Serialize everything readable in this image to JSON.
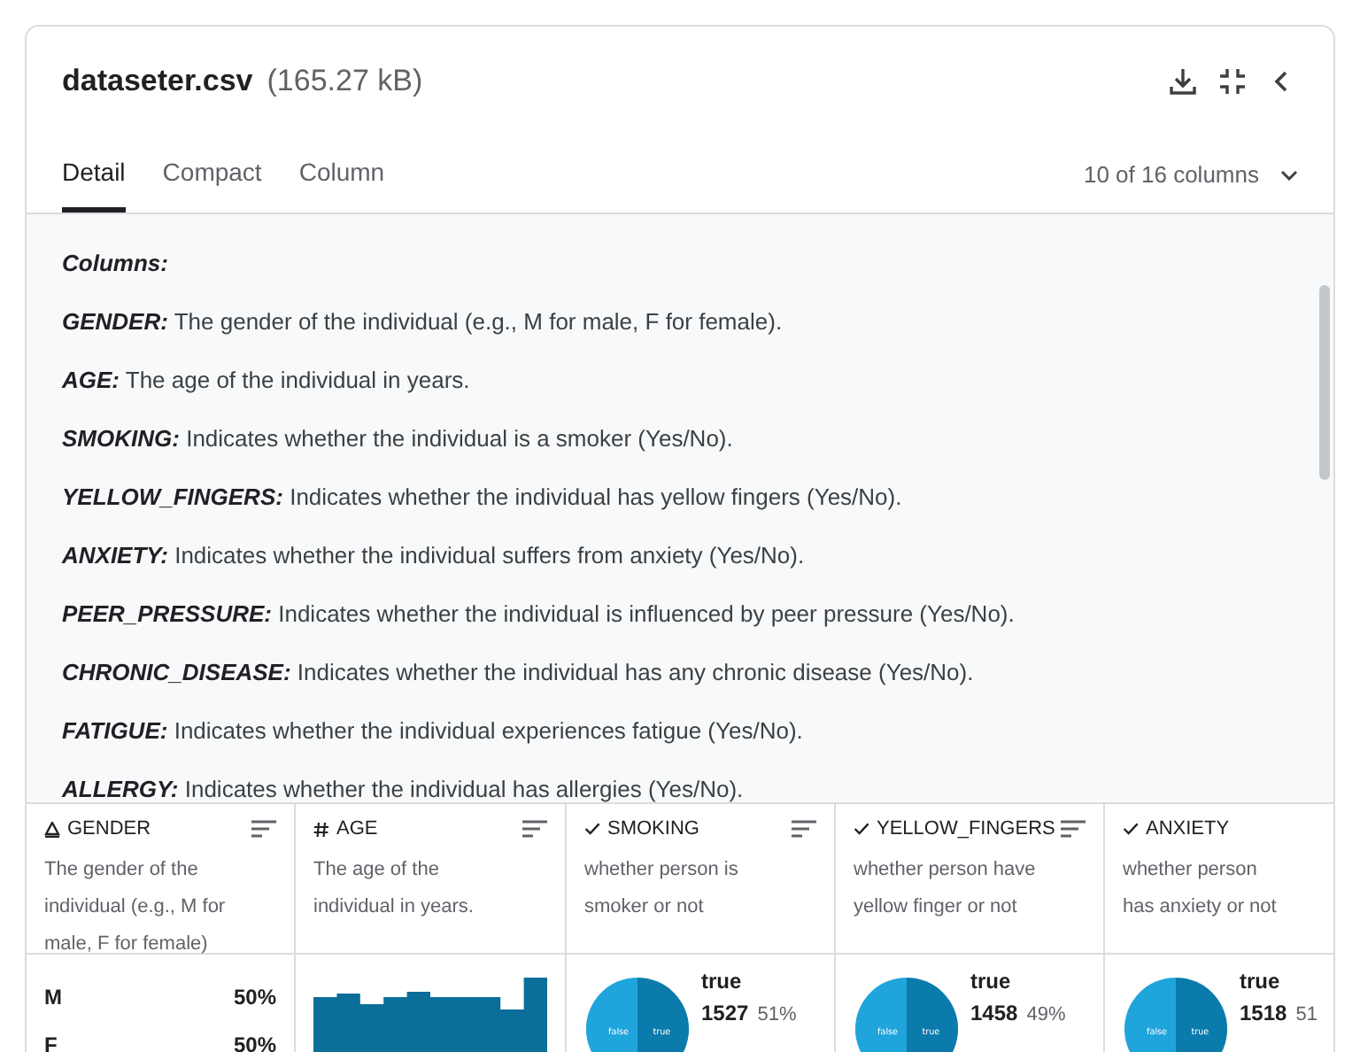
{
  "file": {
    "name": "dataseter.csv",
    "size": "(165.27 kB)"
  },
  "tabs": [
    {
      "label": "Detail",
      "selected": true
    },
    {
      "label": "Compact",
      "selected": false
    },
    {
      "label": "Column",
      "selected": false
    }
  ],
  "column_selector": "10 of 16 columns",
  "description": {
    "heading": "Columns:",
    "items": [
      {
        "name": "GENDER:",
        "text": "The gender of the individual (e.g., M for male, F for female)."
      },
      {
        "name": "AGE:",
        "text": "The age of the individual in years."
      },
      {
        "name": "SMOKING:",
        "text": "Indicates whether the individual is a smoker (Yes/No)."
      },
      {
        "name": "YELLOW_FINGERS:",
        "text": "Indicates whether the individual has yellow fingers (Yes/No)."
      },
      {
        "name": "ANXIETY:",
        "text": "Indicates whether the individual suffers from anxiety (Yes/No)."
      },
      {
        "name": "PEER_PRESSURE:",
        "text": "Indicates whether the individual is influenced by peer pressure (Yes/No)."
      },
      {
        "name": "CHRONIC_DISEASE:",
        "text": "Indicates whether the individual has any chronic disease (Yes/No)."
      },
      {
        "name": "FATIGUE:",
        "text": "Indicates whether the individual experiences fatigue (Yes/No)."
      },
      {
        "name": "ALLERGY:",
        "text": "Indicates whether the individual has allergies (Yes/No)."
      }
    ]
  },
  "columns": [
    {
      "kind": "categorical",
      "name": "GENDER",
      "description": "The gender of the individual (e.g., M for male, F for female)",
      "categories": [
        {
          "label": "M",
          "percent": "50%"
        },
        {
          "label": "F",
          "percent": "50%"
        }
      ]
    },
    {
      "kind": "numeric",
      "name": "AGE",
      "description": "The age of the individual in years."
    },
    {
      "kind": "boolean",
      "name": "SMOKING",
      "description": "whether person is smoker or not",
      "pie_labels": [
        "false",
        "true"
      ],
      "true_label": "true",
      "count": "1527",
      "percent": "51%"
    },
    {
      "kind": "boolean",
      "name": "YELLOW_FINGERS",
      "description": "whether person have yellow finger or not",
      "pie_labels": [
        "false",
        "true"
      ],
      "true_label": "true",
      "count": "1458",
      "percent": "49%"
    },
    {
      "kind": "boolean",
      "name": "ANXIETY",
      "description": "whether person has anxiety or not",
      "pie_labels": [
        "false",
        "true"
      ],
      "true_label": "true",
      "count": "1518",
      "percent": "51"
    }
  ]
}
